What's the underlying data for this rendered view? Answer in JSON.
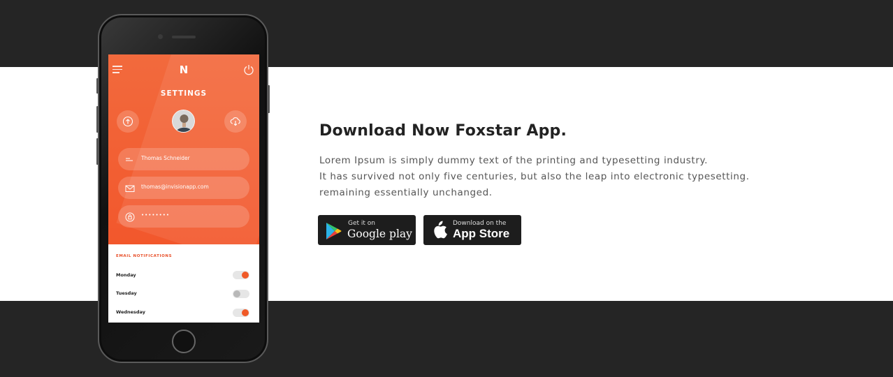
{
  "phone": {
    "logo": "N",
    "screen_title": "SETTINGS",
    "fields": [
      {
        "icon": "name-icon",
        "value": "Thomas Schneider"
      },
      {
        "icon": "mail-icon",
        "value": "thomas@invisionapp.com"
      },
      {
        "icon": "lock-icon",
        "value": "••••••••"
      }
    ],
    "notifications": {
      "title": "EMAIL NOTIFICATIONS",
      "days": [
        {
          "label": "Monday",
          "enabled": true
        },
        {
          "label": "Tuesday",
          "enabled": false
        },
        {
          "label": "Wednesday",
          "enabled": true
        }
      ]
    },
    "accent_color": "#f2572c"
  },
  "content": {
    "heading": "Download Now Foxstar App.",
    "lines": [
      "Lorem Ipsum is simply dummy text of the printing and typesetting industry.",
      "It has survived not only five centuries, but also the leap into electronic typesetting.",
      "remaining essentially unchanged."
    ]
  },
  "stores": {
    "google": {
      "small": "Get it on",
      "big": "Google play",
      "icon": "google-play-icon"
    },
    "apple": {
      "small": "Download on the",
      "big": "App Store",
      "icon": "apple-icon"
    }
  }
}
